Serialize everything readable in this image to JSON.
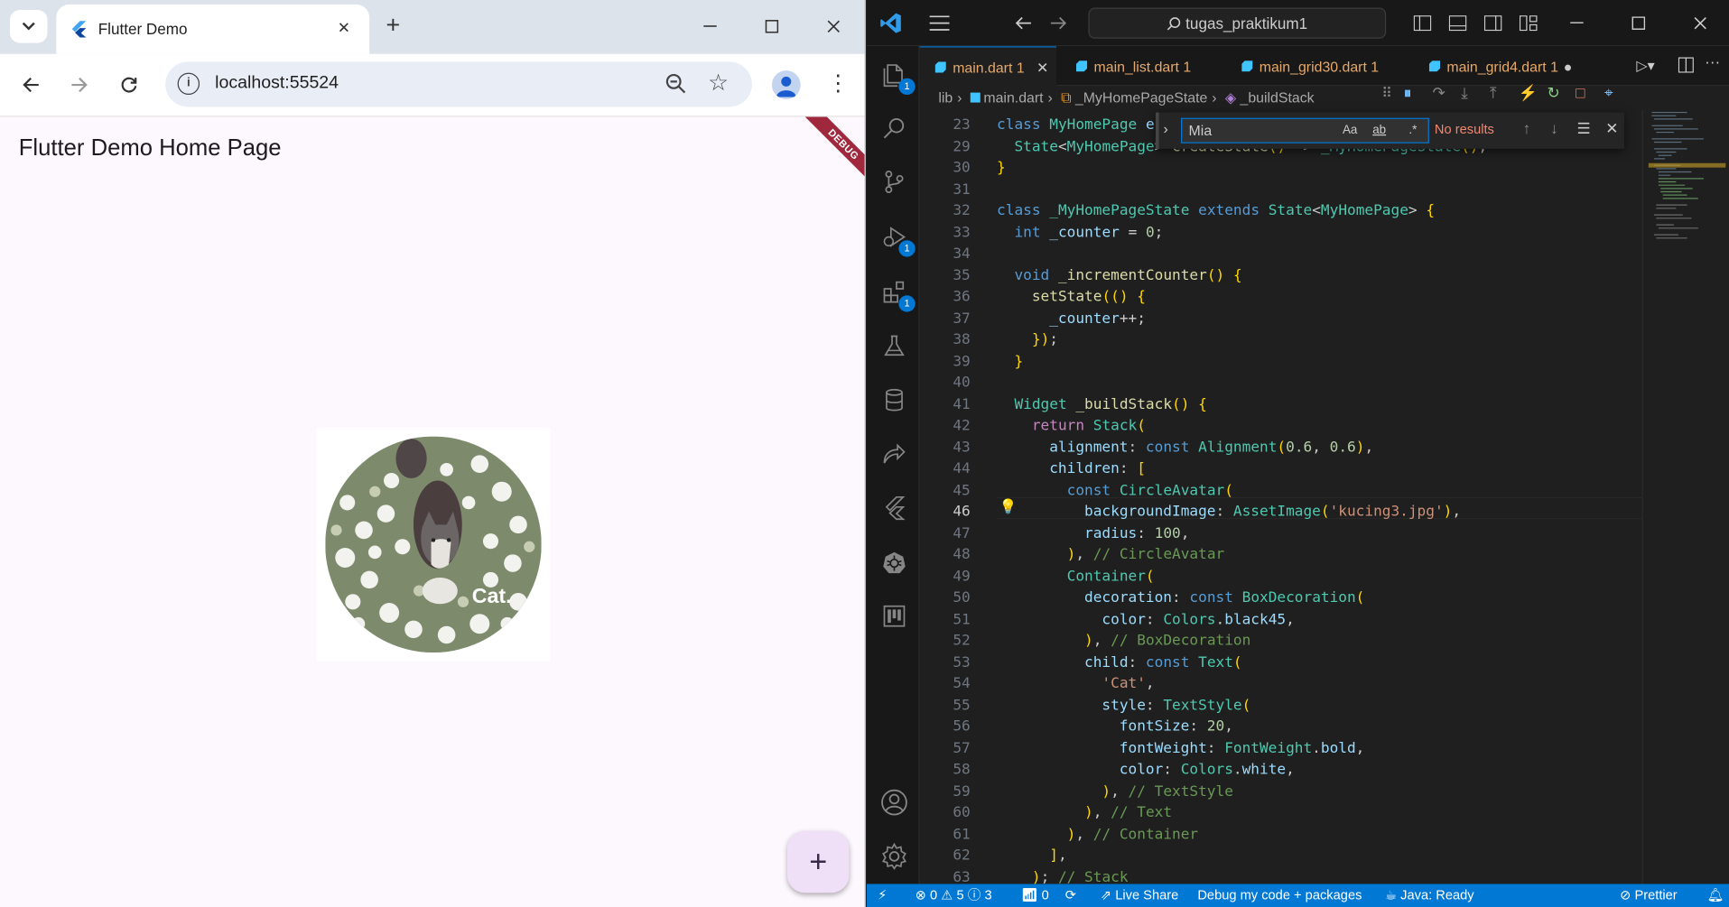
{
  "browser": {
    "tab_title": "Flutter Demo",
    "url": "localhost:55524",
    "colors": {
      "tabstrip": "#dde3ea",
      "omnibox": "#e9eef6"
    }
  },
  "app": {
    "title": "Flutter Demo Home Page",
    "debug_banner": "DEBUG",
    "avatar_caption": "Cat.",
    "fab_label": "+",
    "colors": {
      "background": "#fdf7fe",
      "fab": "#efe0f8",
      "banner": "#a0283c"
    }
  },
  "vscode": {
    "command_center": "tugas_praktikum1",
    "tabs": [
      {
        "label": "main.dart",
        "problems": "1",
        "active": true
      },
      {
        "label": "main_list.dart",
        "problems": "1",
        "active": false
      },
      {
        "label": "main_grid30.dart",
        "problems": "1",
        "active": false
      },
      {
        "label": "main_grid4.dart",
        "problems": "1",
        "active": false
      }
    ],
    "breadcrumb": [
      "lib",
      "main.dart",
      "_MyHomePageState",
      "_buildStack"
    ],
    "find": {
      "query": "Mia",
      "status": "No results",
      "options": [
        "Aa",
        "ab",
        ".*"
      ]
    },
    "activity_badges": {
      "explorer": "1",
      "run_debug": "1",
      "extensions": "1"
    },
    "code_lines": [
      {
        "n": "23",
        "text": "class MyHomePage e"
      },
      {
        "n": "29",
        "text": "  State<MyHomePage> createState() => _MyHomePageState();"
      },
      {
        "n": "30",
        "text": "}"
      },
      {
        "n": "31",
        "text": ""
      },
      {
        "n": "32",
        "text": "class _MyHomePageState extends State<MyHomePage> {"
      },
      {
        "n": "33",
        "text": "  int _counter = 0;"
      },
      {
        "n": "34",
        "text": ""
      },
      {
        "n": "35",
        "text": "  void _incrementCounter() {"
      },
      {
        "n": "36",
        "text": "    setState(() {"
      },
      {
        "n": "37",
        "text": "      _counter++;"
      },
      {
        "n": "38",
        "text": "    });"
      },
      {
        "n": "39",
        "text": "  }"
      },
      {
        "n": "40",
        "text": ""
      },
      {
        "n": "41",
        "text": "  Widget _buildStack() {"
      },
      {
        "n": "42",
        "text": "    return Stack("
      },
      {
        "n": "43",
        "text": "      alignment: const Alignment(0.6, 0.6),"
      },
      {
        "n": "44",
        "text": "      children: ["
      },
      {
        "n": "45",
        "text": "        const CircleAvatar("
      },
      {
        "n": "46",
        "text": "          backgroundImage: AssetImage('kucing3.jpg'),"
      },
      {
        "n": "47",
        "text": "          radius: 100,"
      },
      {
        "n": "48",
        "text": "        ), // CircleAvatar"
      },
      {
        "n": "49",
        "text": "        Container("
      },
      {
        "n": "50",
        "text": "          decoration: const BoxDecoration("
      },
      {
        "n": "51",
        "text": "            color: Colors.black45,"
      },
      {
        "n": "52",
        "text": "          ), // BoxDecoration"
      },
      {
        "n": "53",
        "text": "          child: const Text("
      },
      {
        "n": "54",
        "text": "            'Cat',"
      },
      {
        "n": "55",
        "text": "            style: TextStyle("
      },
      {
        "n": "56",
        "text": "              fontSize: 20,"
      },
      {
        "n": "57",
        "text": "              fontWeight: FontWeight.bold,"
      },
      {
        "n": "58",
        "text": "              color: Colors.white,"
      },
      {
        "n": "59",
        "text": "            ), // TextStyle"
      },
      {
        "n": "60",
        "text": "          ), // Text"
      },
      {
        "n": "61",
        "text": "        ), // Container"
      },
      {
        "n": "62",
        "text": "      ],"
      },
      {
        "n": "63",
        "text": "    ); // Stack"
      }
    ],
    "current_line": "46",
    "status": {
      "errors": "0",
      "warnings": "5",
      "infos": "3",
      "ports": "0",
      "live_share": "Live Share",
      "debug_mode": "Debug my code + packages",
      "java": "Java: Ready",
      "prettier": "Prettier"
    },
    "colors": {
      "accent": "#0078d4",
      "editor_bg": "#1f1f1f",
      "sidebar_bg": "#181818",
      "tab_modified": "#e7a96a"
    }
  }
}
